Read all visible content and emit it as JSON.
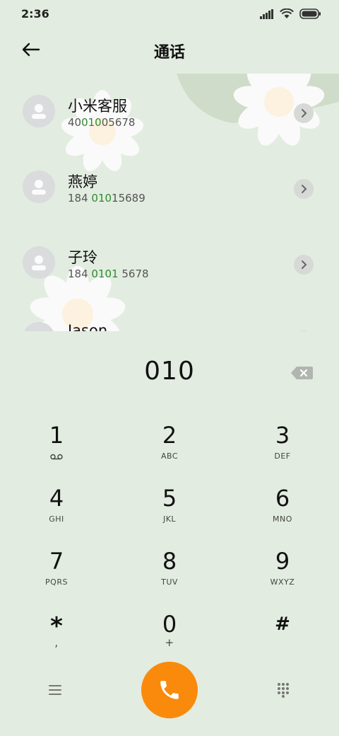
{
  "status_bar": {
    "time": "2:36",
    "icons": [
      "signal-icon",
      "wifi-icon",
      "battery-icon"
    ]
  },
  "header": {
    "title": "通话",
    "back_icon": "arrow-left-icon"
  },
  "contacts": [
    {
      "name": "小米客服",
      "number_pre": "40",
      "number_hl": "010",
      "number_post": "05678"
    },
    {
      "name": "燕婷",
      "number_pre": "184 ",
      "number_hl": "010",
      "number_post": "15689"
    },
    {
      "name": "子玲",
      "number_pre": "184 ",
      "number_hl": "0101",
      "number_post": " 5678"
    },
    {
      "name": "Jason",
      "number_pre": "",
      "number_hl": "",
      "number_post": ""
    }
  ],
  "dialer": {
    "number": "010",
    "backspace_icon": "backspace-icon"
  },
  "keypad": [
    {
      "digit": "1",
      "letters": ""
    },
    {
      "digit": "2",
      "letters": "ABC"
    },
    {
      "digit": "3",
      "letters": "DEF"
    },
    {
      "digit": "4",
      "letters": "GHI"
    },
    {
      "digit": "5",
      "letters": "JKL"
    },
    {
      "digit": "6",
      "letters": "MNO"
    },
    {
      "digit": "7",
      "letters": "PQRS"
    },
    {
      "digit": "8",
      "letters": "TUV"
    },
    {
      "digit": "9",
      "letters": "WXYZ"
    },
    {
      "digit": "*",
      "letters": ","
    },
    {
      "digit": "0",
      "letters": "+"
    },
    {
      "digit": "#",
      "letters": ""
    }
  ],
  "bottom_bar": {
    "menu_icon": "menu-icon",
    "call_icon": "phone-icon",
    "keypad_icon": "dialpad-icon"
  },
  "colors": {
    "background": "#e2ece0",
    "call_button": "#f98a0c",
    "match_highlight": "#2e8b2e"
  }
}
